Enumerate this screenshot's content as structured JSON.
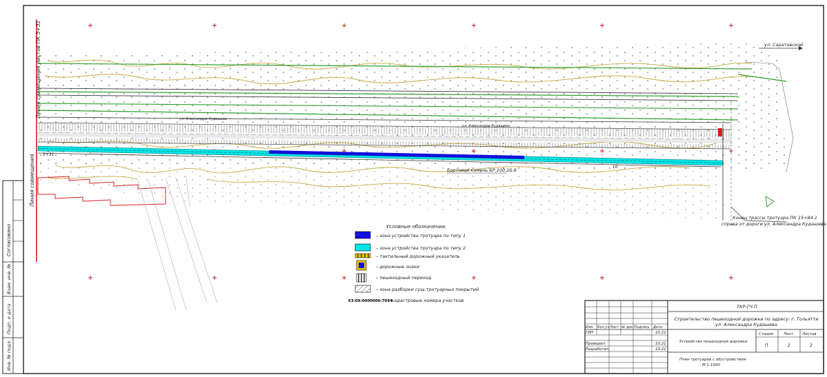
{
  "plan": {
    "street_label": "ул. Саратовской",
    "red_line_label": "Линия совмещения листов ПК 5+31",
    "red_line_label_left": "Линия совмещения",
    "road_label_1": "ул. Александра Кудашева",
    "road_label_2": "ул. Александра Кудашева",
    "cadastre_label": "Бортовой камень БР 100.20.8",
    "chainage_1": "5+31",
    "chainage_2": "10",
    "end_label_1": "Конец трассы тротуара ПК 15+84.1",
    "end_label_2": "справа от дороги ул. Александра Кудашева"
  },
  "legend": {
    "title": "Условные обозначения:",
    "items": [
      {
        "swatch": "blue",
        "label": "– зона устройства тротуара по типу 1"
      },
      {
        "swatch": "cyan",
        "label": "– зона устройства тротуара по типу 2"
      },
      {
        "swatch": "tactile",
        "label": "– тактильный дорожный указатель"
      },
      {
        "swatch": "sign",
        "label": "– дорожные знаки"
      },
      {
        "swatch": "crossing",
        "label": "– пешеходный переход"
      },
      {
        "swatch": "hatch",
        "label": "– зона разборки сущ.тротуарных покрытий"
      }
    ],
    "cadastre_code": "63:09:0000000:7054",
    "cadastre_desc": "– кадастровые номера участков"
  },
  "side_stamp": {
    "rows": [
      "Согласовано",
      "Взам. инв. №",
      "Подп. и дата",
      "Инв. № подл."
    ]
  },
  "title_block": {
    "code": "ТКР-ГЧ.П",
    "project_title": "Строительство пешеходной дорожки по адресу: г. Тольятти ул. Александра Кудашева",
    "section_title": "Устройство пешеходной дорожки",
    "sheet_title": "План тротуаров с обустройством",
    "scale": "М 1:1000",
    "headers": [
      "Изм.",
      "Кол.уч",
      "Лист",
      "№ док.",
      "Подпись",
      "Дата"
    ],
    "rows": [
      {
        "role": "ГИП",
        "date": "10.21"
      },
      {
        "role": "Проверил",
        "date": "10.21"
      },
      {
        "role": "Разработал",
        "date": "10.21"
      }
    ],
    "stage_header": "Стадия",
    "sheet_header": "Лист",
    "sheets_header": "Листов",
    "stage": "П",
    "sheet": "2",
    "sheets": "2"
  },
  "colors": {
    "type1": "#1010e0",
    "type2": "#00e5e5",
    "green_line": "#2ea02e",
    "red_line": "#d42020",
    "contour": "#c8a63a",
    "cross_marker": "#c01818"
  }
}
